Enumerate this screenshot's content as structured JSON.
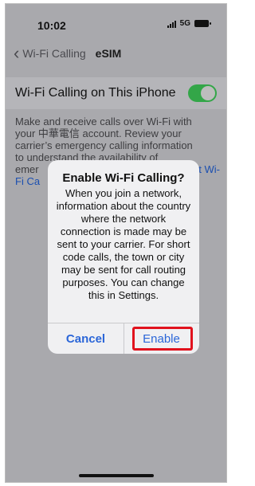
{
  "status_bar": {
    "time": "10:02",
    "network": "5G"
  },
  "nav": {
    "back_label": "Wi-Fi Calling",
    "title": "eSIM"
  },
  "toggle": {
    "label": "Wi-Fi Calling on This iPhone",
    "state": "on",
    "color": "#33a648"
  },
  "description": {
    "line1": "Make and receive calls over Wi-Fi with",
    "line2": "your 中華電信 account. Review your",
    "line3": "carrier’s emergency calling information",
    "line4": "to understand the availability of",
    "line5_start": "emer",
    "line5_end": "t Wi-",
    "line6": "Fi Ca"
  },
  "dialog": {
    "title": "Enable Wi-Fi Calling?",
    "body": "When you join a network, information about the country where the network connection is made may be sent to your carrier. For short code calls, the town or city may be sent for call routing purposes. You can change this in Settings.",
    "cancel_label": "Cancel",
    "enable_label": "Enable"
  },
  "colors": {
    "accent": "#2b66d8",
    "highlight": "#e1121d"
  }
}
